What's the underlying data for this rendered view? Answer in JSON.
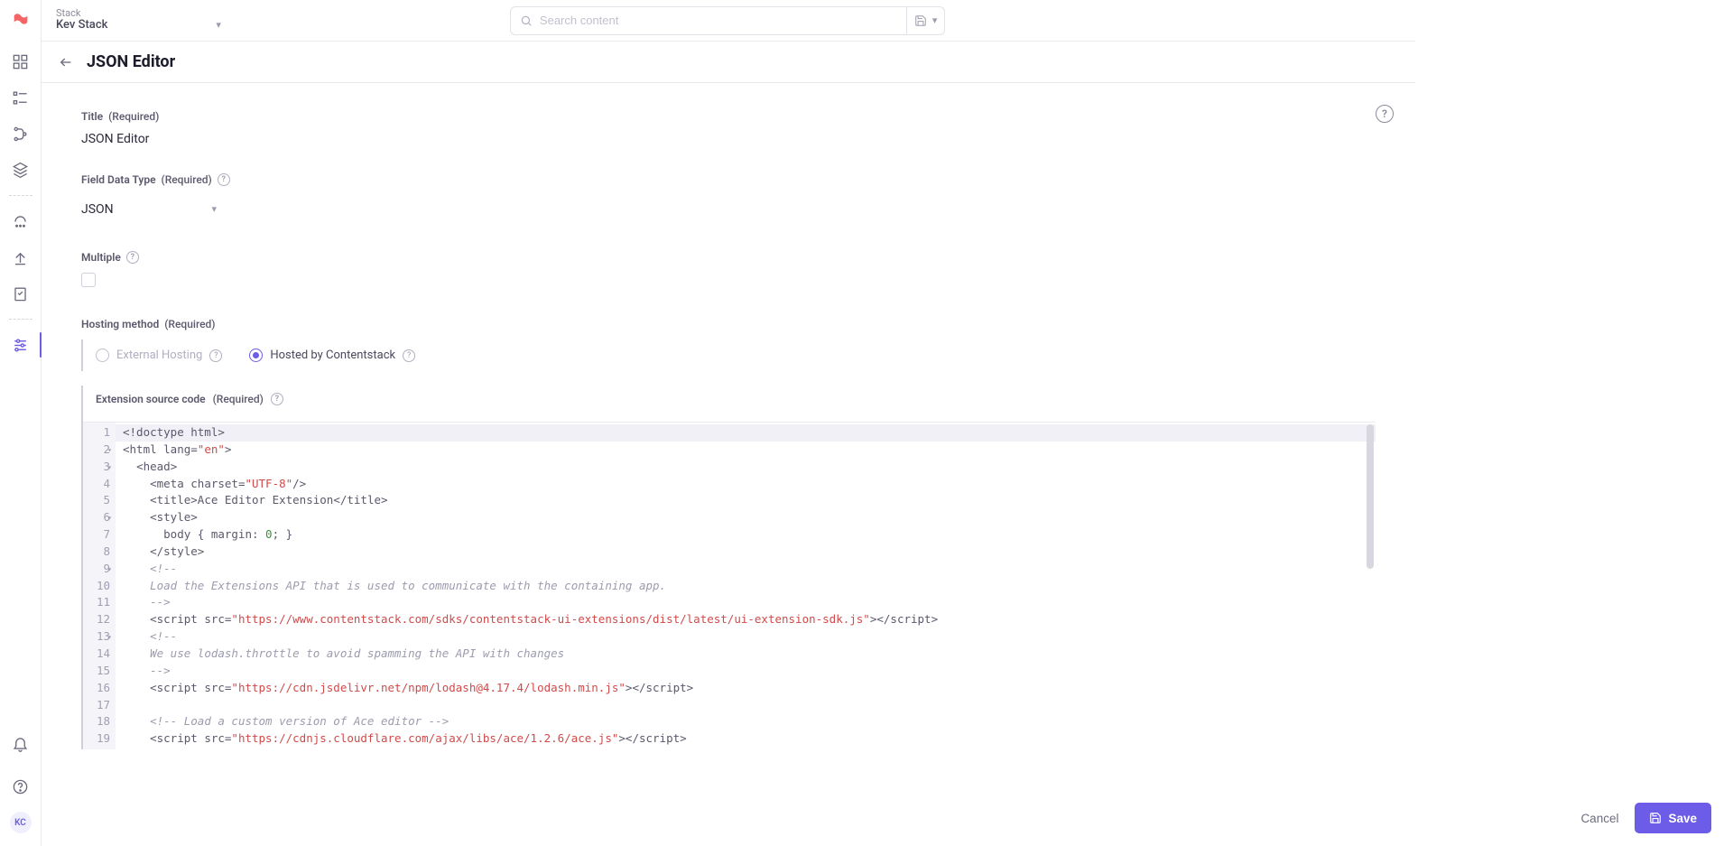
{
  "stack": {
    "label": "Stack",
    "name": "Kev Stack"
  },
  "search": {
    "placeholder": "Search content"
  },
  "page": {
    "title": "JSON Editor"
  },
  "fields": {
    "title": {
      "label": "Title",
      "req": "(Required)",
      "value": "JSON Editor"
    },
    "data_type": {
      "label": "Field Data Type",
      "req": "(Required)",
      "value": "JSON"
    },
    "multiple": {
      "label": "Multiple"
    },
    "hosting": {
      "label": "Hosting method",
      "req": "(Required)",
      "options": {
        "external": "External Hosting",
        "hosted": "Hosted by Contentstack"
      },
      "selected": "hosted"
    },
    "source": {
      "label": "Extension source code",
      "req": "(Required)"
    }
  },
  "code_lines": [
    {
      "n": 1,
      "fold": "",
      "html": "<span class='t-tag'>&lt;!doctype html&gt;</span>",
      "hl": true
    },
    {
      "n": 2,
      "fold": "▾",
      "html": "<span class='t-tag'>&lt;html lang=</span><span class='t-str'>\"en\"</span><span class='t-tag'>&gt;</span>"
    },
    {
      "n": 3,
      "fold": "▾",
      "html": "  <span class='t-tag'>&lt;head&gt;</span>"
    },
    {
      "n": 4,
      "fold": "",
      "html": "    <span class='t-tag'>&lt;meta charset=</span><span class='t-str'>\"UTF-8\"</span><span class='t-tag'>/&gt;</span>"
    },
    {
      "n": 5,
      "fold": "",
      "html": "    <span class='t-tag'>&lt;title&gt;</span>Ace Editor Extension<span class='t-tag'>&lt;/title&gt;</span>"
    },
    {
      "n": 6,
      "fold": "▾",
      "html": "    <span class='t-tag'>&lt;style&gt;</span>"
    },
    {
      "n": 7,
      "fold": "",
      "html": "      body { margin: <span class='t-num'>0</span>; }"
    },
    {
      "n": 8,
      "fold": "",
      "html": "    <span class='t-tag'>&lt;/style&gt;</span>"
    },
    {
      "n": 9,
      "fold": "▾",
      "html": "    <span class='t-cmt'>&lt;!--</span>"
    },
    {
      "n": 10,
      "fold": "",
      "html": "    <span class='t-cmt'>Load the Extensions API that is used to communicate with the containing app.</span>"
    },
    {
      "n": 11,
      "fold": "",
      "html": "    <span class='t-cmt'>--&gt;</span>"
    },
    {
      "n": 12,
      "fold": "",
      "html": "    <span class='t-tag'>&lt;script src=</span><span class='t-str'>\"https://www.contentstack.com/sdks/contentstack-ui-extensions/dist/latest/ui-extension-sdk.js\"</span><span class='t-tag'>&gt;&lt;/script&gt;</span>"
    },
    {
      "n": 13,
      "fold": "▾",
      "html": "    <span class='t-cmt'>&lt;!--</span>"
    },
    {
      "n": 14,
      "fold": "",
      "html": "    <span class='t-cmt'>We use lodash.throttle to avoid spamming the API with changes</span>"
    },
    {
      "n": 15,
      "fold": "",
      "html": "    <span class='t-cmt'>--&gt;</span>"
    },
    {
      "n": 16,
      "fold": "",
      "html": "    <span class='t-tag'>&lt;script src=</span><span class='t-str'>\"https://cdn.jsdelivr.net/npm/lodash@4.17.4/lodash.min.js\"</span><span class='t-tag'>&gt;&lt;/script&gt;</span>"
    },
    {
      "n": 17,
      "fold": "",
      "html": ""
    },
    {
      "n": 18,
      "fold": "",
      "html": "    <span class='t-cmt'>&lt;!-- Load a custom version of Ace editor --&gt;</span>"
    },
    {
      "n": 19,
      "fold": "",
      "html": "    <span class='t-tag'>&lt;script src=</span><span class='t-str'>\"https://cdnjs.cloudflare.com/ajax/libs/ace/1.2.6/ace.js\"</span><span class='t-tag'>&gt;&lt;/script&gt;</span>"
    }
  ],
  "footer": {
    "cancel": "Cancel",
    "save": "Save"
  },
  "avatar": "KC"
}
